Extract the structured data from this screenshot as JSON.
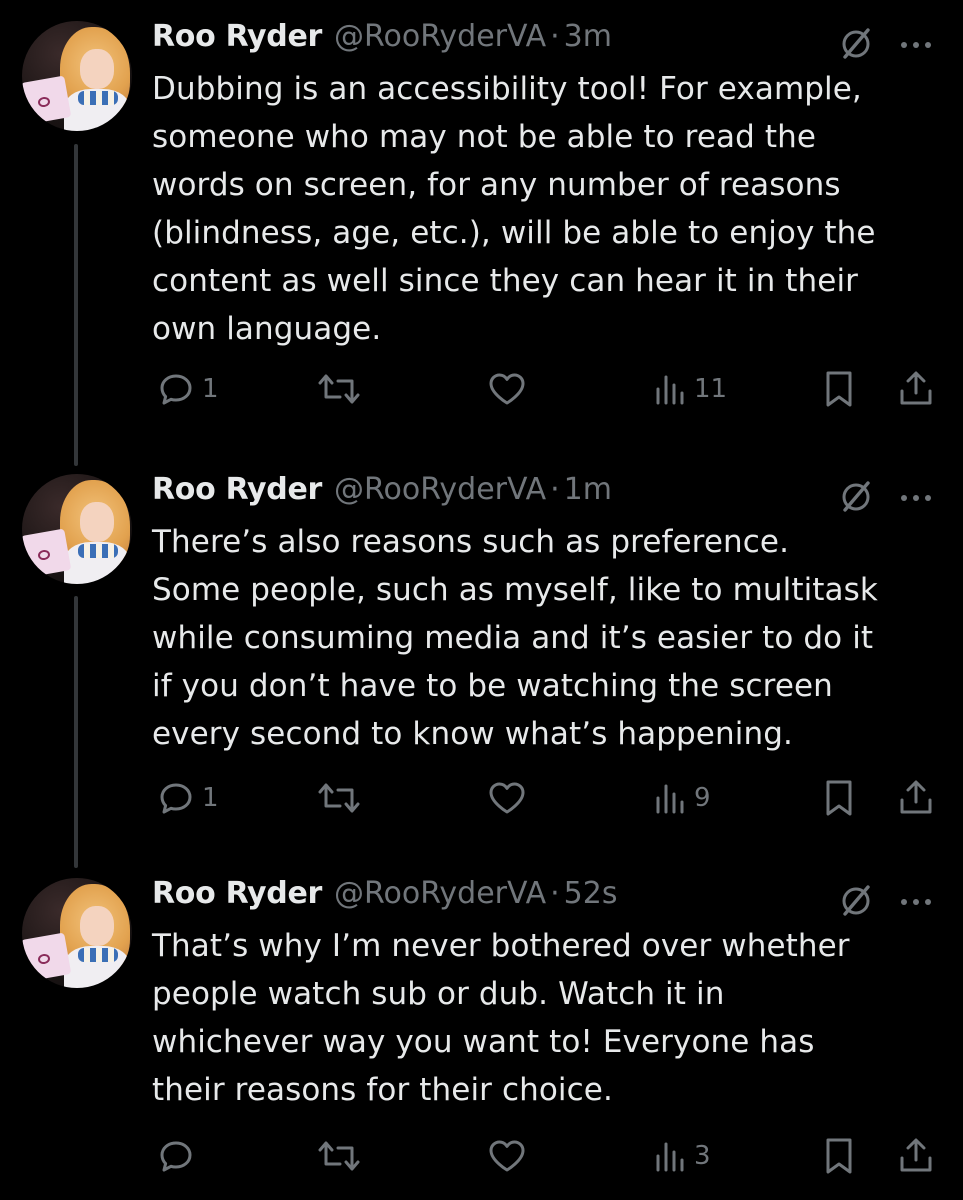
{
  "colors": {
    "background": "#000000",
    "text_primary": "#e7e9ea",
    "text_secondary": "#71767b",
    "thread_line": "#333639"
  },
  "icons": {
    "reply": "reply-icon",
    "retweet": "retweet-icon",
    "like": "heart-icon",
    "views": "views-chart-icon",
    "bookmark": "bookmark-icon",
    "share": "share-icon",
    "not_following": "prohibited-icon",
    "more": "more-dots-icon"
  },
  "tweets": [
    {
      "name": "Roo Ryder",
      "handle": "@RooRyderVA",
      "separator": "·",
      "time": "3m",
      "lines": [
        "Dubbing is an accessibility tool! For example,",
        "someone who may not be able to read the",
        "words on screen, for any number of reasons",
        "(blindness, age, etc.), will be able to enjoy the",
        "content as well since they can hear it in their",
        "own language."
      ],
      "replies": "1",
      "retweets": "",
      "likes": "",
      "views": "11"
    },
    {
      "name": "Roo Ryder",
      "handle": "@RooRyderVA",
      "separator": "·",
      "time": "1m",
      "lines": [
        "There’s also reasons such as preference.",
        "Some people, such as myself, like to multitask",
        "while consuming media and it’s easier to do it",
        "if you don’t have to be watching the screen",
        "every second to know what’s happening."
      ],
      "replies": "1",
      "retweets": "",
      "likes": "",
      "views": "9"
    },
    {
      "name": "Roo Ryder",
      "handle": "@RooRyderVA",
      "separator": "·",
      "time": "52s",
      "lines": [
        "That’s why I’m never bothered over whether",
        "people watch sub or dub. Watch it in",
        "whichever way you want to! Everyone has",
        "their reasons for their choice."
      ],
      "replies": "",
      "retweets": "",
      "likes": "",
      "views": "3"
    }
  ]
}
